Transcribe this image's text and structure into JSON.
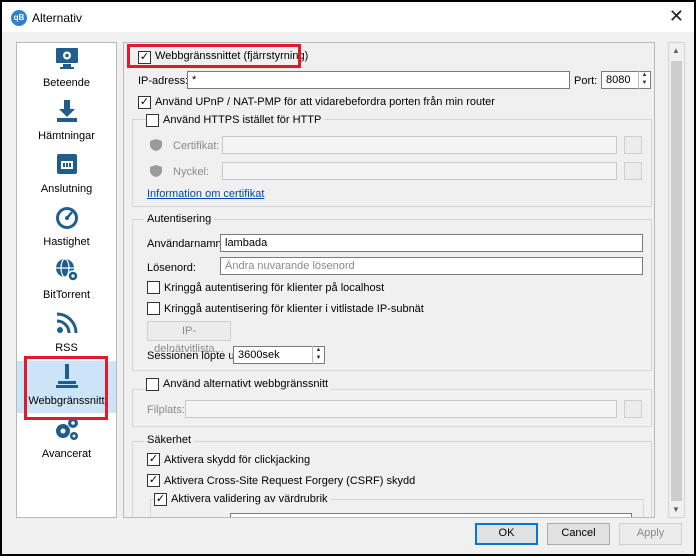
{
  "window": {
    "title": "Alternativ",
    "app_icon": "qB"
  },
  "sidebar": {
    "items": [
      {
        "label": "Beteende",
        "icon": "monitor-gear-icon"
      },
      {
        "label": "Hämtningar",
        "icon": "download-icon"
      },
      {
        "label": "Anslutning",
        "icon": "network-icon"
      },
      {
        "label": "Hastighet",
        "icon": "speedometer-icon"
      },
      {
        "label": "BitTorrent",
        "icon": "globe-gear-icon"
      },
      {
        "label": "RSS",
        "icon": "rss-icon"
      },
      {
        "label": "Webbgränssnitt",
        "icon": "web-ui-icon",
        "selected": true
      },
      {
        "label": "Avancerat",
        "icon": "gears-icon"
      }
    ]
  },
  "webui": {
    "enable_label": "Webbgränssnittet (fjärrstyrning)",
    "ip_label": "IP-adress:",
    "ip_value": "*",
    "port_label": "Port:",
    "port_value": "8080",
    "upnp_label": "Använd UPnP / NAT-PMP för att vidarebefordra porten från min router",
    "https_label": "Använd HTTPS istället för HTTP",
    "cert_label": "Certifikat:",
    "key_label": "Nyckel:",
    "cert_info_link": "Information om certifikat"
  },
  "auth": {
    "group_title": "Autentisering",
    "username_label": "Användarnamn:",
    "username_value": "lambada",
    "password_label": "Lösenord:",
    "password_placeholder": "Ändra nuvarande lösenord",
    "bypass_localhost": "Kringgå autentisering för klienter på localhost",
    "bypass_whitelist": "Kringgå autentisering för klienter i vitlistade IP-subnät",
    "ip_subnet_button": "IP-delnätvitlista...",
    "session_label": "Sessionen löpte ut:",
    "session_value": "3600sek"
  },
  "alt_webui": {
    "label": "Använd alternativt webbgränssnitt",
    "location_label": "Filplats:"
  },
  "security": {
    "group_title": "Säkerhet",
    "clickjacking": "Aktivera skydd för clickjacking",
    "csrf": "Aktivera Cross-Site Request Forgery (CSRF) skydd",
    "host_header": "Aktivera validering av värdrubrik"
  },
  "buttons": {
    "ok": "OK",
    "cancel": "Cancel",
    "apply": "Apply"
  },
  "colors": {
    "highlight": "#e0192c",
    "icon": "#1f5e8c",
    "link": "#0645ad"
  }
}
